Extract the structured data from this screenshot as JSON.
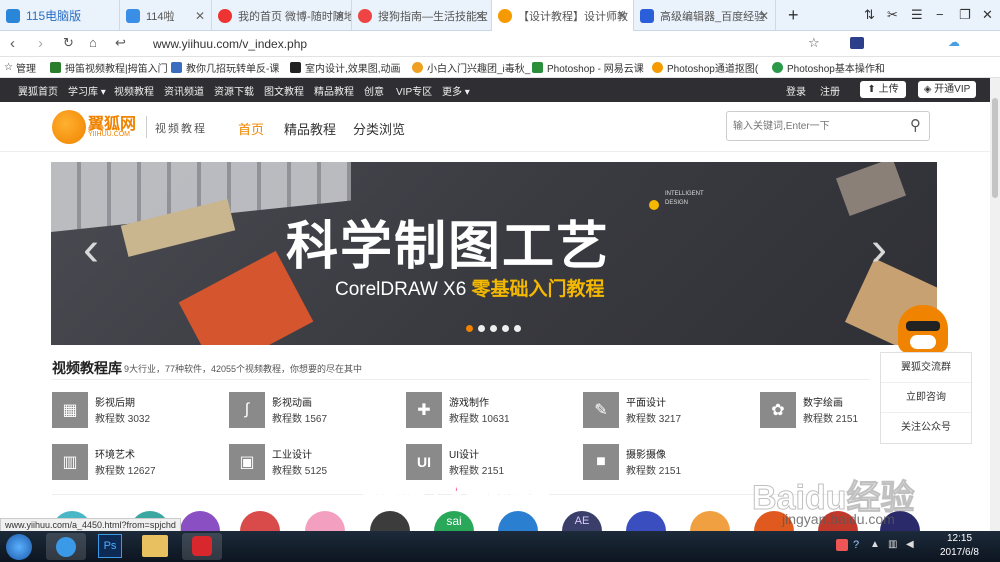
{
  "tabs": [
    {
      "label": "115电脑版",
      "icon": "browser-logo-icon",
      "color": "#2a86d8"
    },
    {
      "label": "114啦",
      "icon": "114-icon",
      "color": "#3a8ee6"
    },
    {
      "label": "我的首页 微博-随时随地",
      "icon": "weibo-icon",
      "color": "#e33"
    },
    {
      "label": "搜狗指南—生活技能宝",
      "icon": "sogou-icon",
      "color": "#e44"
    },
    {
      "label": "【设计教程】设计师教",
      "icon": "yiihuu-icon",
      "color": "#f59a00"
    },
    {
      "label": "高级编辑器_百度经验",
      "icon": "baidu-icon",
      "color": "#2b5fd9"
    }
  ],
  "new_tab": "+",
  "url": "www.yiihuu.com/v_index.php",
  "bookmarks": [
    {
      "label": "管理",
      "icon": "star-icon"
    },
    {
      "label": "拇笛视频教程|拇笛入门",
      "icon": "bookmark-icon"
    },
    {
      "label": "教你几招玩转单反-课",
      "icon": "bookmark-icon"
    },
    {
      "label": "室内设计,效果图,动画",
      "icon": "bookmark-icon"
    },
    {
      "label": "小白入门兴趣团_i毒秋_",
      "icon": "bookmark-icon"
    },
    {
      "label": "Photoshop - 网易云课",
      "icon": "bookmark-icon"
    },
    {
      "label": "Photoshop通道抠图(",
      "icon": "bookmark-icon"
    },
    {
      "label": "Photoshop基本操作和",
      "icon": "bookmark-icon"
    }
  ],
  "site_nav": [
    "翼狐首页",
    "学习库 ▾",
    "视频教程",
    "资讯频道",
    "资源下载",
    "图文教程",
    "精品教程",
    "创意",
    "VIP专区",
    "更多 ▾"
  ],
  "site_nav_right": {
    "login": "登录",
    "register": "注册",
    "upload": "上传",
    "vip": "开通VIP"
  },
  "header": {
    "logo_text": "翼狐网",
    "logo_sub": "YIIHUU.COM",
    "section_title": "视频教程",
    "menu": [
      "首页",
      "精品教程",
      "分类浏览"
    ],
    "search_placeholder": "输入关键词,Enter一下"
  },
  "banner": {
    "title": "科学制图工艺",
    "subtitle_prefix": "CorelDRAW X6 ",
    "subtitle_highlight": "零基础入门教程",
    "tag": "INTELLIGENT DESIGN",
    "dots": 5,
    "active_dot": 0
  },
  "library": {
    "title": "视频教程库",
    "desc": "9大行业，77种软件，42055个视频教程，你想要的尽在其中",
    "categories": [
      {
        "name": "影视后期",
        "count": "教程数 3032",
        "icon": "film-icon"
      },
      {
        "name": "影视动画",
        "count": "教程数 1567",
        "icon": "animation-icon"
      },
      {
        "name": "游戏制作",
        "count": "教程数 10631",
        "icon": "gamepad-icon"
      },
      {
        "name": "平面设计",
        "count": "教程数 3217",
        "icon": "design-tools-icon"
      },
      {
        "name": "数字绘画",
        "count": "教程数 2151",
        "icon": "palette-icon"
      },
      {
        "name": "环境艺术",
        "count": "教程数 12627",
        "icon": "building-icon"
      },
      {
        "name": "工业设计",
        "count": "教程数 5125",
        "icon": "industrial-icon"
      },
      {
        "name": "UI设计",
        "count": "教程数 2151",
        "icon": "ui-icon"
      },
      {
        "name": "摄影摄像",
        "count": "教程数 2151",
        "icon": "camera-icon"
      }
    ]
  },
  "float_menu": [
    "翼狐交流群",
    "立即咨询",
    "关注公众号"
  ],
  "subtitle_overlay": "傻傻两个人笑的多甜",
  "status_url": "www.yiihuu.com/a_4450.html?from=spjchd",
  "software_icons": [
    "sai",
    "AE"
  ],
  "watermark": "Baidu经验",
  "watermark_sub": "jingyan.baidu.com",
  "clock": {
    "time": "12:15",
    "date": "2017/6/8"
  },
  "colors": {
    "accent": "#f08300",
    "nav_bg": "#2f2f33",
    "banner_highlight": "#f5b800"
  }
}
